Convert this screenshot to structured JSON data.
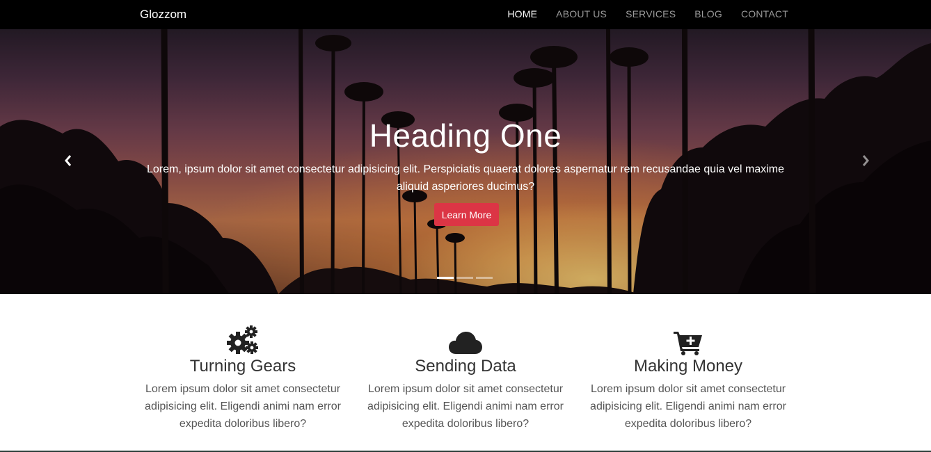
{
  "navbar": {
    "brand": "Glozzom",
    "links": [
      {
        "label": "HOME",
        "active": true
      },
      {
        "label": "ABOUT US",
        "active": false
      },
      {
        "label": "SERVICES",
        "active": false
      },
      {
        "label": "BLOG",
        "active": false
      },
      {
        "label": "CONTACT",
        "active": false
      }
    ]
  },
  "hero": {
    "title": "Heading One",
    "text": "Lorem, ipsum dolor sit amet consectetur adipisicing elit. Perspiciatis quaerat dolores aspernatur rem recusandae quia vel maxime aliquid asperiores ducimus?",
    "button_label": "Learn More",
    "prev_icon": "chevron-left-icon",
    "next_icon": "chevron-right-icon",
    "slide_count": 3,
    "active_slide": 1
  },
  "features": [
    {
      "icon": "gears-icon",
      "title": "Turning Gears",
      "text": "Lorem ipsum dolor sit amet consectetur adipisicing elit. Eligendi animi nam error expedita doloribus libero?"
    },
    {
      "icon": "cloud-icon",
      "title": "Sending Data",
      "text": "Lorem ipsum dolor sit amet consectetur adipisicing elit. Eligendi animi nam error expedita doloribus libero?"
    },
    {
      "icon": "cart-plus-icon",
      "title": "Making Money",
      "text": "Lorem ipsum dolor sit amet consectetur adipisicing elit. Eligendi animi nam error expedita doloribus libero?"
    }
  ],
  "colors": {
    "navbar_bg": "#000000",
    "accent_button": "#dc3545",
    "nav_inactive": "#9a9a9a",
    "nav_active": "#ffffff"
  }
}
